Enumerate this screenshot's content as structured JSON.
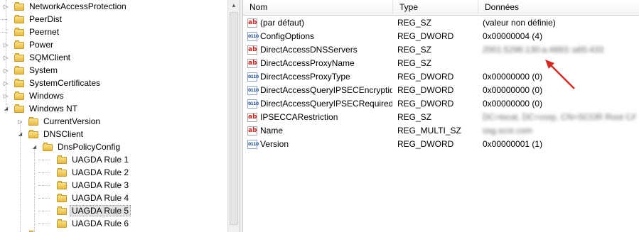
{
  "tree": {
    "nodes": [
      {
        "label": "NetworkAccessProtection",
        "level": 1,
        "expander": "collapsed",
        "selected": false
      },
      {
        "label": "PeerDist",
        "level": 1,
        "expander": "none",
        "selected": false
      },
      {
        "label": "Peernet",
        "level": 1,
        "expander": "none",
        "selected": false
      },
      {
        "label": "Power",
        "level": 1,
        "expander": "collapsed",
        "selected": false
      },
      {
        "label": "SQMClient",
        "level": 1,
        "expander": "collapsed",
        "selected": false
      },
      {
        "label": "System",
        "level": 1,
        "expander": "collapsed",
        "selected": false
      },
      {
        "label": "SystemCertificates",
        "level": 1,
        "expander": "collapsed",
        "selected": false
      },
      {
        "label": "Windows",
        "level": 1,
        "expander": "collapsed",
        "selected": false
      },
      {
        "label": "Windows NT",
        "level": 1,
        "expander": "expanded",
        "selected": false
      },
      {
        "label": "CurrentVersion",
        "level": 2,
        "expander": "collapsed",
        "selected": false
      },
      {
        "label": "DNSClient",
        "level": 2,
        "expander": "expanded",
        "selected": false
      },
      {
        "label": "DnsPolicyConfig",
        "level": 3,
        "expander": "expanded",
        "selected": false
      },
      {
        "label": "UAGDA Rule 1",
        "level": 4,
        "expander": "none",
        "selected": false
      },
      {
        "label": "UAGDA Rule 2",
        "level": 4,
        "expander": "none",
        "selected": false
      },
      {
        "label": "UAGDA Rule 3",
        "level": 4,
        "expander": "none",
        "selected": false
      },
      {
        "label": "UAGDA Rule 4",
        "level": 4,
        "expander": "none",
        "selected": false
      },
      {
        "label": "UAGDA Rule 5",
        "level": 4,
        "expander": "none",
        "selected": true
      },
      {
        "label": "UAGDA Rule 6",
        "level": 4,
        "expander": "none",
        "selected": false
      }
    ]
  },
  "list": {
    "columns": [
      "Nom",
      "Type",
      "Données"
    ],
    "rows": [
      {
        "name": "(par défaut)",
        "type": "REG_SZ",
        "data": "(valeur non définie)",
        "icon": "string-value-icon",
        "blurred": false
      },
      {
        "name": "ConfigOptions",
        "type": "REG_DWORD",
        "data": "0x00000004 (4)",
        "icon": "dword-value-icon",
        "blurred": false
      },
      {
        "name": "DirectAccessDNSServers",
        "type": "REG_SZ",
        "data": "2001:5296:130:a:4893::a65:433",
        "icon": "string-value-icon",
        "blurred": true
      },
      {
        "name": "DirectAccessProxyName",
        "type": "REG_SZ",
        "data": "",
        "icon": "string-value-icon",
        "blurred": false
      },
      {
        "name": "DirectAccessProxyType",
        "type": "REG_DWORD",
        "data": "0x00000000 (0)",
        "icon": "dword-value-icon",
        "blurred": false
      },
      {
        "name": "DirectAccessQueryIPSECEncryption",
        "type": "REG_DWORD",
        "data": "0x00000000 (0)",
        "icon": "dword-value-icon",
        "blurred": false
      },
      {
        "name": "DirectAccessQueryIPSECRequired",
        "type": "REG_DWORD",
        "data": "0x00000000 (0)",
        "icon": "dword-value-icon",
        "blurred": false
      },
      {
        "name": "IPSECCARestriction",
        "type": "REG_SZ",
        "data": "DC=local, DC=corp, CN=SCOR Root CA",
        "icon": "string-value-icon",
        "blurred": true
      },
      {
        "name": "Name",
        "type": "REG_MULTI_SZ",
        "data": "ssg.scor.com",
        "icon": "string-value-icon",
        "blurred": true
      },
      {
        "name": "Version",
        "type": "REG_DWORD",
        "data": "0x00000001 (1)",
        "icon": "dword-value-icon",
        "blurred": false
      }
    ]
  },
  "colors": {
    "arrow": "#d42a1f",
    "selection": "#e3e3e3",
    "folder": "#e8b93c"
  }
}
